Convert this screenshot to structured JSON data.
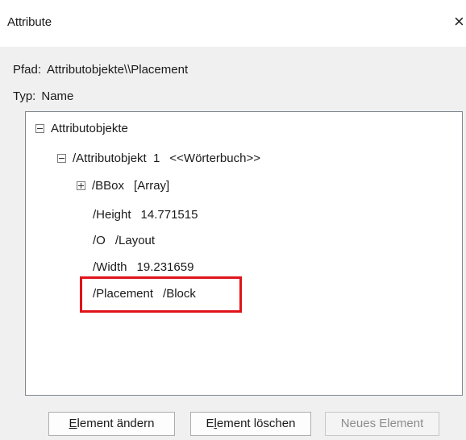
{
  "window": {
    "title": "Attribute",
    "close_glyph": "×"
  },
  "fields": {
    "path_label": "Pfad:",
    "path_value": "Attributobjekte\\\\Placement",
    "type_label": "Typ:",
    "type_value": "Name"
  },
  "tree": {
    "root": {
      "label": "Attributobjekte",
      "expanded": true
    },
    "object": {
      "label": "/Attributobjekt  1",
      "type": "<<Wörterbuch>>",
      "expanded": true
    },
    "entries": [
      {
        "key": "/BBox",
        "value": "[Array]",
        "expandable": true
      },
      {
        "key": "/Height",
        "value": "14.771515"
      },
      {
        "key": "/O",
        "value": "/Layout"
      },
      {
        "key": "/Width",
        "value": "19.231659"
      },
      {
        "key": "/Placement",
        "value": "/Block",
        "highlighted": true
      }
    ]
  },
  "buttons": {
    "change_first": "E",
    "change_rest": "lement ändern",
    "delete_first": "E",
    "delete_mnemonic": "l",
    "delete_rest": "ement löschen",
    "new": "Neues Element",
    "new_enabled": false
  },
  "colors": {
    "highlight": "#e0131a",
    "background": "#f0f0f0"
  }
}
